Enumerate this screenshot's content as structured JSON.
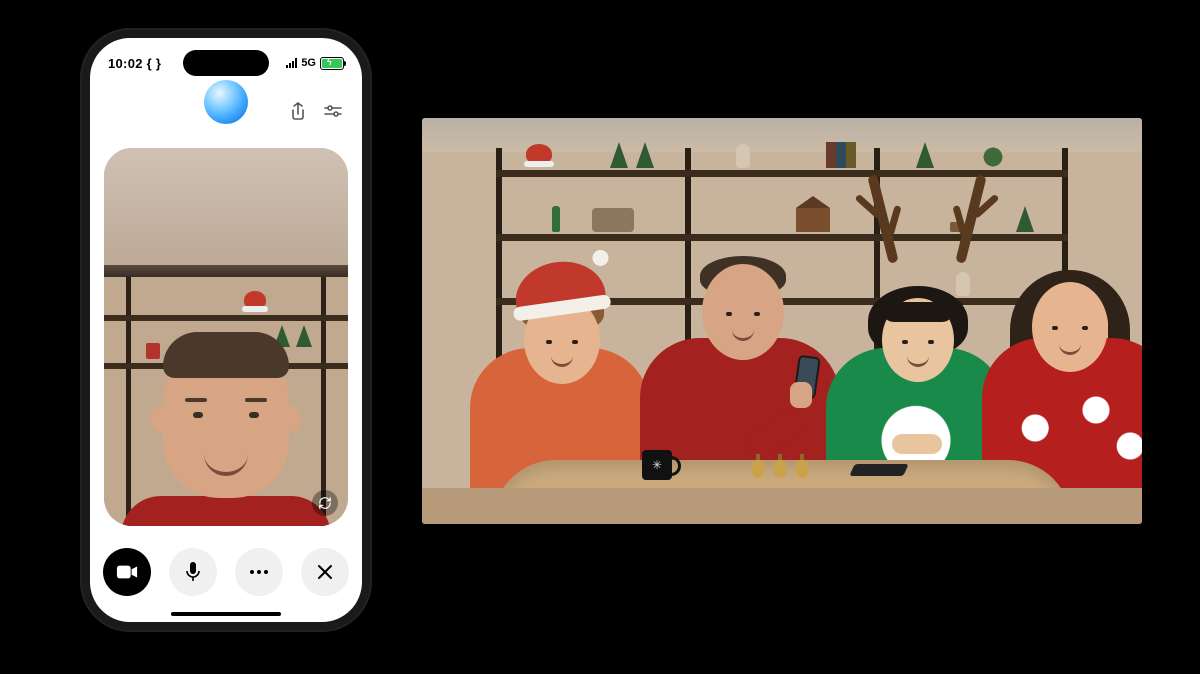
{
  "status_bar": {
    "time": "10:02",
    "time_suffix": " { }",
    "network_label": "5G"
  },
  "app_header": {
    "share_icon": "share-icon",
    "settings_icon": "sliders-icon",
    "assistant_orb": "assistant-orb"
  },
  "camera_view": {
    "flip_icon": "flip-camera-icon"
  },
  "controls": {
    "video": {
      "icon": "video-camera-icon",
      "active": true
    },
    "mic": {
      "icon": "microphone-icon"
    },
    "more": {
      "icon": "more-dots-icon"
    },
    "close": {
      "icon": "close-x-icon"
    }
  },
  "studio_scene": {
    "people_count": 4,
    "mug_logo": "✳"
  }
}
